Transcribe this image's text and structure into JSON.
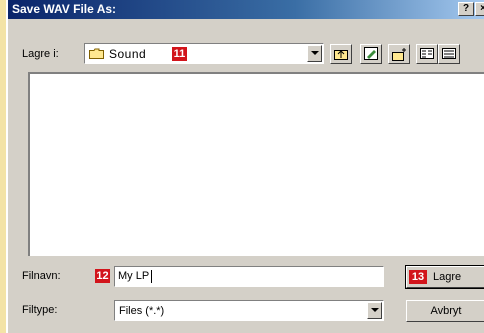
{
  "window": {
    "title": "Save WAV File As:",
    "help_label": "?",
    "close_label": "×"
  },
  "save_in": {
    "label": "Lagre i:",
    "value": "Sound",
    "badge": "11"
  },
  "filename": {
    "label": "Filnavn:",
    "value": "My LP",
    "badge": "12"
  },
  "filetype": {
    "label": "Filtype:",
    "value": "Files (*.*)"
  },
  "buttons": {
    "save_label": "Lagre",
    "save_badge": "13",
    "cancel_label": "Avbryt"
  },
  "icons": [
    "folder-icon",
    "up-one-level-icon",
    "desktop-icon",
    "new-folder-icon",
    "list-view-icon",
    "details-view-icon"
  ],
  "colors": {
    "badge": "#d2141b",
    "titlebar": "#0a246a",
    "background": "#f3e3a6"
  }
}
